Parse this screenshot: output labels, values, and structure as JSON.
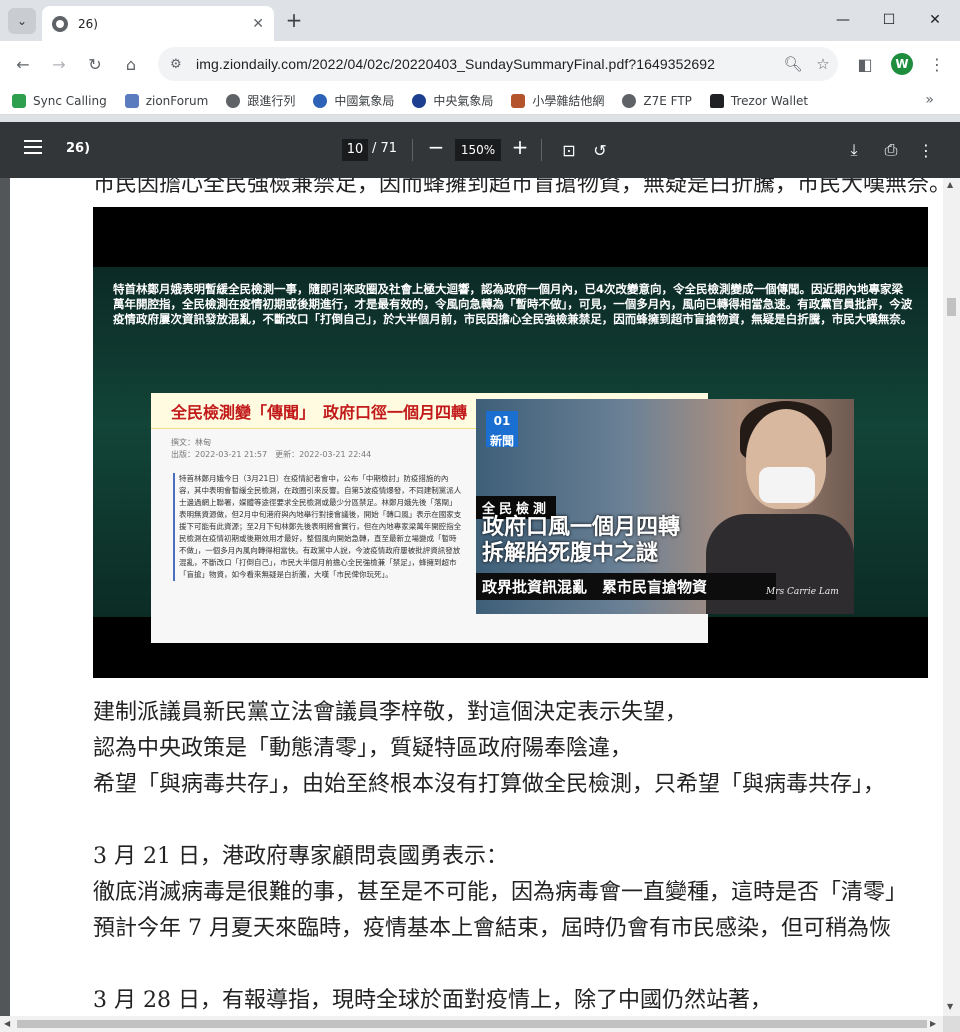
{
  "browser": {
    "tab_title": "26)",
    "url": "img.ziondaily.com/2022/04/02c/20220403_SundaySummaryFinal.pdf?1649352692",
    "profile_initial": "W",
    "bookmarks": [
      {
        "label": "Sync Calling",
        "color": "#2e9e4f"
      },
      {
        "label": "zionForum",
        "color": "#5b7bbf"
      },
      {
        "label": "跟進行列",
        "color": "#5f6368"
      },
      {
        "label": "中國氣象局",
        "color": "#2d62b8"
      },
      {
        "label": "中央氣象局",
        "color": "#1c3f8f"
      },
      {
        "label": "小學雜結他網",
        "color": "#b3542c"
      },
      {
        "label": "Z7E FTP",
        "color": "#5f6368"
      },
      {
        "label": "Trezor Wallet",
        "color": "#202124"
      }
    ]
  },
  "pdf": {
    "title": "26)",
    "current_page": "10",
    "total_pages": "/ 71",
    "zoom": "150%"
  },
  "content": {
    "cut_line": "市民因擔心全民強檢兼禁足，因而蜂擁到超市盲搶物資，無疑是白折騰，市民大嘆無奈。",
    "image": {
      "overlay_text": "特首林鄭月娥表明暫緩全民檢測一事，隨即引來政圈及社會上極大迴響，認為政府一個月內，已4次改變意向，令全民檢測變成一個傳聞。因近期內地專家梁萬年開腔指，全民檢測在疫情初期或後期進行，才是最有效的，令風向急轉為「暫時不做」，可見，一個多月內，風向已轉得相當急速。有政黨官員批評，今波疫情政府屢次資訊發放混亂，不斷改口「打倒自己」，於大半個月前，市民因擔心全民強檢兼禁足，因而蜂擁到超市盲搶物資，無疑是白折騰，市民大嘆無奈。",
      "clip_headline": "全民檢測變「傳聞」　政府口徑一個月四轉　市民搶購物資白折騰",
      "clip_meta": "撰文：林甸\n出版：2022-03-21 21:57　更新：2022-03-21 22:44",
      "clip_body": "特首林鄭月娥今日（3月21日）在疫情記者會中，公布「中期檢討」防疫措施的內容，其中表明會暫緩全民檢測，在政圈引來反響。自第5波疫情爆發，不同建制黨派人士邊過網上聯署，媒體等途徑要求全民檢測或最少分區禁足。林鄭月娥先後「落閘」表明無資源做，但2月中旬港府與內地舉行對接會議後，開始「轉口風」表示在國家支援下可能有此資源；至2月下旬林鄭先後表明將會實行，但在內地專家梁萬年開腔指全民檢測在疫情初期或後期效用才最好，整個風向開始急轉，直至最新立場變成「暫時不做」，一個多月內風向轉得相當快。有政黨中人說，今波疫情政府屢被批評資訊發放混亂，不斷改口「打倒自己」，市民大半個月前擔心全民強檢兼「禁足」，蜂擁到超市「盲搶」物資，如今看來無疑是白折騰，大嘆「市民俾你玩死」。",
      "video_logo": "01 新聞",
      "video_band": "全民檢測",
      "video_headline_1": "政府口風一個月四轉",
      "video_headline_2": "拆解胎死腹中之謎",
      "video_band2": "政界批資訊混亂　累市民盲搶物資",
      "video_signature": "Mrs Carrie Lam"
    },
    "paragraphs": [
      "建制派議員新民黨立法會議員李梓敬，對這個決定表示失望，",
      "認為中央政策是「動態清零」，質疑特區政府陽奉陰違，",
      "希望「與病毒共存」，由始至終根本沒有打算做全民檢測，只希望「與病毒共存」，",
      "",
      "3 月 21 日，港政府專家顧問袁國勇表示：",
      "徹底消滅病毒是很難的事，甚至是不可能，因為病毒會一直變種，這時是否「清零」",
      "預計今年 7 月夏天來臨時，疫情基本上會結束，屆時仍會有市民感染，但可稍為恢",
      "",
      "3 月 28 日，有報導指，現時全球於面對疫情上，除了中國仍然站著，"
    ]
  }
}
